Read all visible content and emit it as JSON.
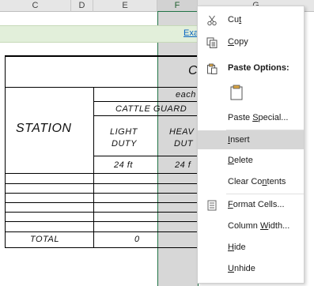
{
  "columns": [
    "C",
    "D",
    "E",
    "F",
    "G"
  ],
  "sheet": {
    "link_text": "Exa",
    "title_fragment": "C",
    "header_each": "each",
    "header_cattle_guard": "CATTLE GUARD",
    "station_label": "STATION",
    "light_duty": [
      "LIGHT",
      "DUTY"
    ],
    "heavy_duty": [
      "HEAV",
      "DUT"
    ],
    "length_light": "24 ft",
    "length_heavy": "24 f",
    "total_label": "TOTAL",
    "total_light": "0"
  },
  "context_menu": {
    "items": [
      {
        "label": "Cut",
        "accel": "t",
        "icon": "scissors-icon"
      },
      {
        "label": "Copy",
        "accel": "C",
        "icon": "copy-icon"
      },
      {
        "label": "Paste Options:",
        "accel": "",
        "icon": "paste-icon"
      },
      {
        "label": "",
        "accel": "",
        "icon": "paste-clipboard-icon"
      },
      {
        "label": "Paste Special...",
        "accel": "S",
        "icon": ""
      },
      {
        "label": "Insert",
        "accel": "I",
        "icon": ""
      },
      {
        "label": "Delete",
        "accel": "D",
        "icon": ""
      },
      {
        "label": "Clear Contents",
        "accel": "n",
        "icon": ""
      },
      {
        "label": "Format Cells...",
        "accel": "F",
        "icon": "format-cells-icon"
      },
      {
        "label": "Column Width...",
        "accel": "W",
        "icon": ""
      },
      {
        "label": "Hide",
        "accel": "H",
        "icon": ""
      },
      {
        "label": "Unhide",
        "accel": "U",
        "icon": ""
      }
    ],
    "highlighted": "Insert"
  }
}
